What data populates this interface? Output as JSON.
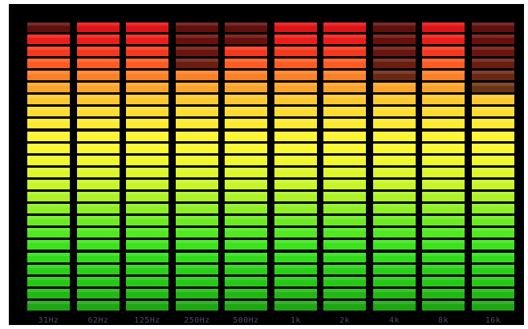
{
  "equalizer": {
    "segment_count": 24,
    "bands": [
      {
        "label": "31Hz",
        "level": 23
      },
      {
        "label": "62Hz",
        "level": 24
      },
      {
        "label": "125Hz",
        "level": 24
      },
      {
        "label": "250Hz",
        "level": 20
      },
      {
        "label": "500Hz",
        "level": 22
      },
      {
        "label": "1k",
        "level": 24
      },
      {
        "label": "2k",
        "level": 24
      },
      {
        "label": "4k",
        "level": 19
      },
      {
        "label": "8k",
        "level": 24
      },
      {
        "label": "16k",
        "level": 18
      }
    ],
    "colors": {
      "panel": "#000000",
      "label": "#4a4a6a",
      "lit": [
        "#1ca812",
        "#22b814",
        "#26c816",
        "#2ad018",
        "#30dc1a",
        "#3ce21c",
        "#50e81e",
        "#6cec20",
        "#8cf022",
        "#acf224",
        "#c8f426",
        "#dcf628",
        "#eef82a",
        "#f8f82c",
        "#fcf42e",
        "#fcea30",
        "#fcdc30",
        "#fcc82e",
        "#fca42a",
        "#fc8026",
        "#fc5c22",
        "#f4381e",
        "#ec1e1a",
        "#e01416"
      ],
      "unlit": [
        "#0a2a06",
        "#0a2c06",
        "#0c3008",
        "#0c3208",
        "#0e3408",
        "#10380a",
        "#163a0a",
        "#1c3c0a",
        "#243e0c",
        "#2c3e0c",
        "#343e0e",
        "#3a3e0e",
        "#3e3e10",
        "#3e3e10",
        "#5a5a1c",
        "#6a5a1c",
        "#6a501a",
        "#6a4418",
        "#6a3414",
        "#6a2812",
        "#6a1e10",
        "#6a160e",
        "#6a100c",
        "#60100c"
      ]
    }
  }
}
